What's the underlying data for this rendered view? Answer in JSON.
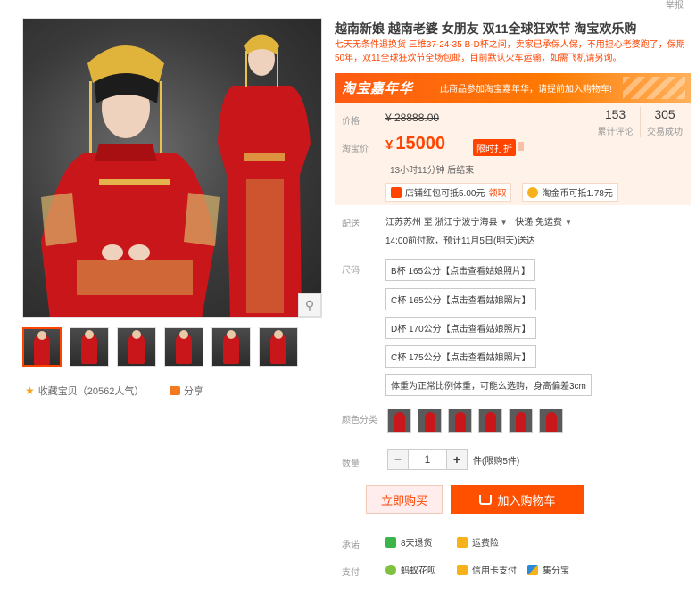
{
  "header": {
    "report_label": "举报"
  },
  "product": {
    "title": "越南新娘 越南老婆 女朋友 双11全球狂欢节 淘宝欢乐购",
    "subtitle": "七天无条件退换货 三维37-24-35 B-D杯之间，卖家已承保人保，不用担心老婆跑了，保期50年，双11全球狂欢节全场包邮，目前默认火车运输，如需飞机请另询。"
  },
  "banner": {
    "logo_text": "淘宝嘉年华",
    "text": "此商品参加淘宝嘉年华，请提前加入购物车!"
  },
  "price": {
    "orig_label": "价格",
    "orig_value": "¥ 28888.00",
    "tb_label": "淘宝价",
    "currency": "¥",
    "value": "15000",
    "badge": "限时打折",
    "countdown": "13小时11分钟 后结束"
  },
  "stats": {
    "comments_count": "153",
    "comments_label": "累计评论",
    "sales_count": "305",
    "sales_label": "交易成功"
  },
  "promos": {
    "redpacket_text": "店铺红包可抵5.00元",
    "redpacket_link": "领取",
    "coin_text": "淘金币可抵1.78元"
  },
  "shipping": {
    "label": "配送",
    "from_to": "江苏苏州 至  浙江宁波宁海县",
    "method": "快递 免运费",
    "time": "14:00前付款，预计11月5日(明天)送达"
  },
  "sizes": {
    "label": "尺码",
    "options": [
      "B杯 165公分【点击查看姑娘照片】",
      "C杯 165公分【点击查看姑娘照片】",
      "D杯 170公分【点击查看姑娘照片】",
      "C杯 175公分【点击查看姑娘照片】",
      "体重为正常比例体重，可能么选购，身高偏差3cm"
    ]
  },
  "colors": {
    "label": "颜色分类",
    "count": 6
  },
  "quantity": {
    "label": "数量",
    "minus": "−",
    "value": "1",
    "plus": "+",
    "limit": "件(限购5件)"
  },
  "actions": {
    "buy_now": "立即购买",
    "add_to_cart": "加入购物车"
  },
  "promise": {
    "label": "承诺",
    "return": "8天退货",
    "insurance": "运费险"
  },
  "payment": {
    "label": "支付",
    "huabei": "蚂蚁花呗",
    "credit": "信用卡支付",
    "jifen": "集分宝"
  },
  "left": {
    "favorite": "收藏宝贝（20562人气）",
    "share": "分享",
    "zoom_icon": "search-icon"
  },
  "colors_hex": {
    "accent": "#ff4400",
    "cart_button": "#ff5000",
    "price_bg": "#fff2e8",
    "dress_red": "#c9161a"
  }
}
